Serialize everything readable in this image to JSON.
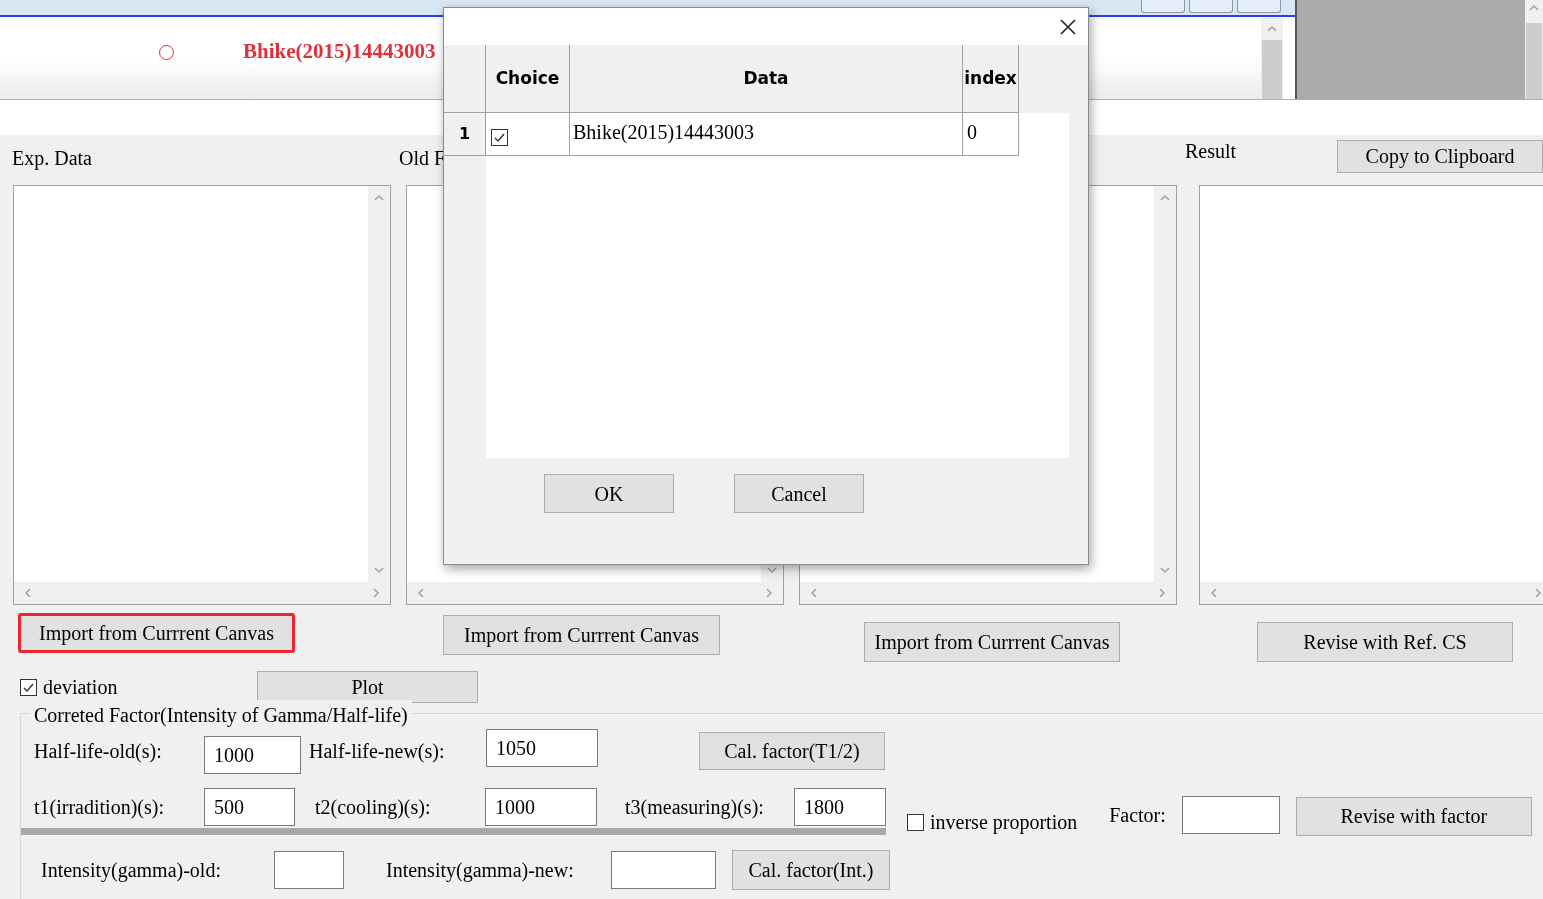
{
  "canvas": {
    "marker_label": "Bhike(2015)14443003"
  },
  "panels": [
    {
      "title": "Exp. Data",
      "button": "Import from Currrent Canvas",
      "highlighted": true
    },
    {
      "title": "Old F",
      "button": "Import from Currrent Canvas",
      "highlighted": false
    },
    {
      "button": "Import from Currrent Canvas",
      "highlighted": false
    },
    {
      "title": "Result",
      "header_button": "Copy to Clipboard",
      "button": "Revise with Ref. CS",
      "highlighted": false
    }
  ],
  "deviation": {
    "label": "deviation",
    "checked": true
  },
  "plot_button": "Plot",
  "correction": {
    "title": "Correted Factor(Intensity of Gamma/Half-life)",
    "half_life_old": {
      "label": "Half-life-old(s):",
      "value": "1000"
    },
    "half_life_new": {
      "label": "Half-life-new(s):",
      "value": "1050"
    },
    "half_life_button": "Cal. factor(T1/2)",
    "t1": {
      "label": "t1(irradition)(s):",
      "value": "500"
    },
    "t2": {
      "label": "t2(cooling)(s):",
      "value": "1000"
    },
    "t3": {
      "label": "t3(measuring)(s):",
      "value": "1800"
    },
    "inverse": {
      "label": "inverse proportion",
      "checked": false
    },
    "factor": {
      "label": "Factor:"
    },
    "factor_button": "Revise with factor",
    "intensity_old": {
      "label": "Intensity(gamma)-old:"
    },
    "intensity_new": {
      "label": "Intensity(gamma)-new:"
    },
    "intensity_button": "Cal. factor(Int.)"
  },
  "dialog": {
    "columns": [
      "Choice",
      "Data",
      "index"
    ],
    "rows": [
      {
        "number": "1",
        "checked": true,
        "data": "Bhike(2015)14443003",
        "index": "0"
      }
    ],
    "buttons": [
      "OK",
      "Cancel"
    ]
  }
}
